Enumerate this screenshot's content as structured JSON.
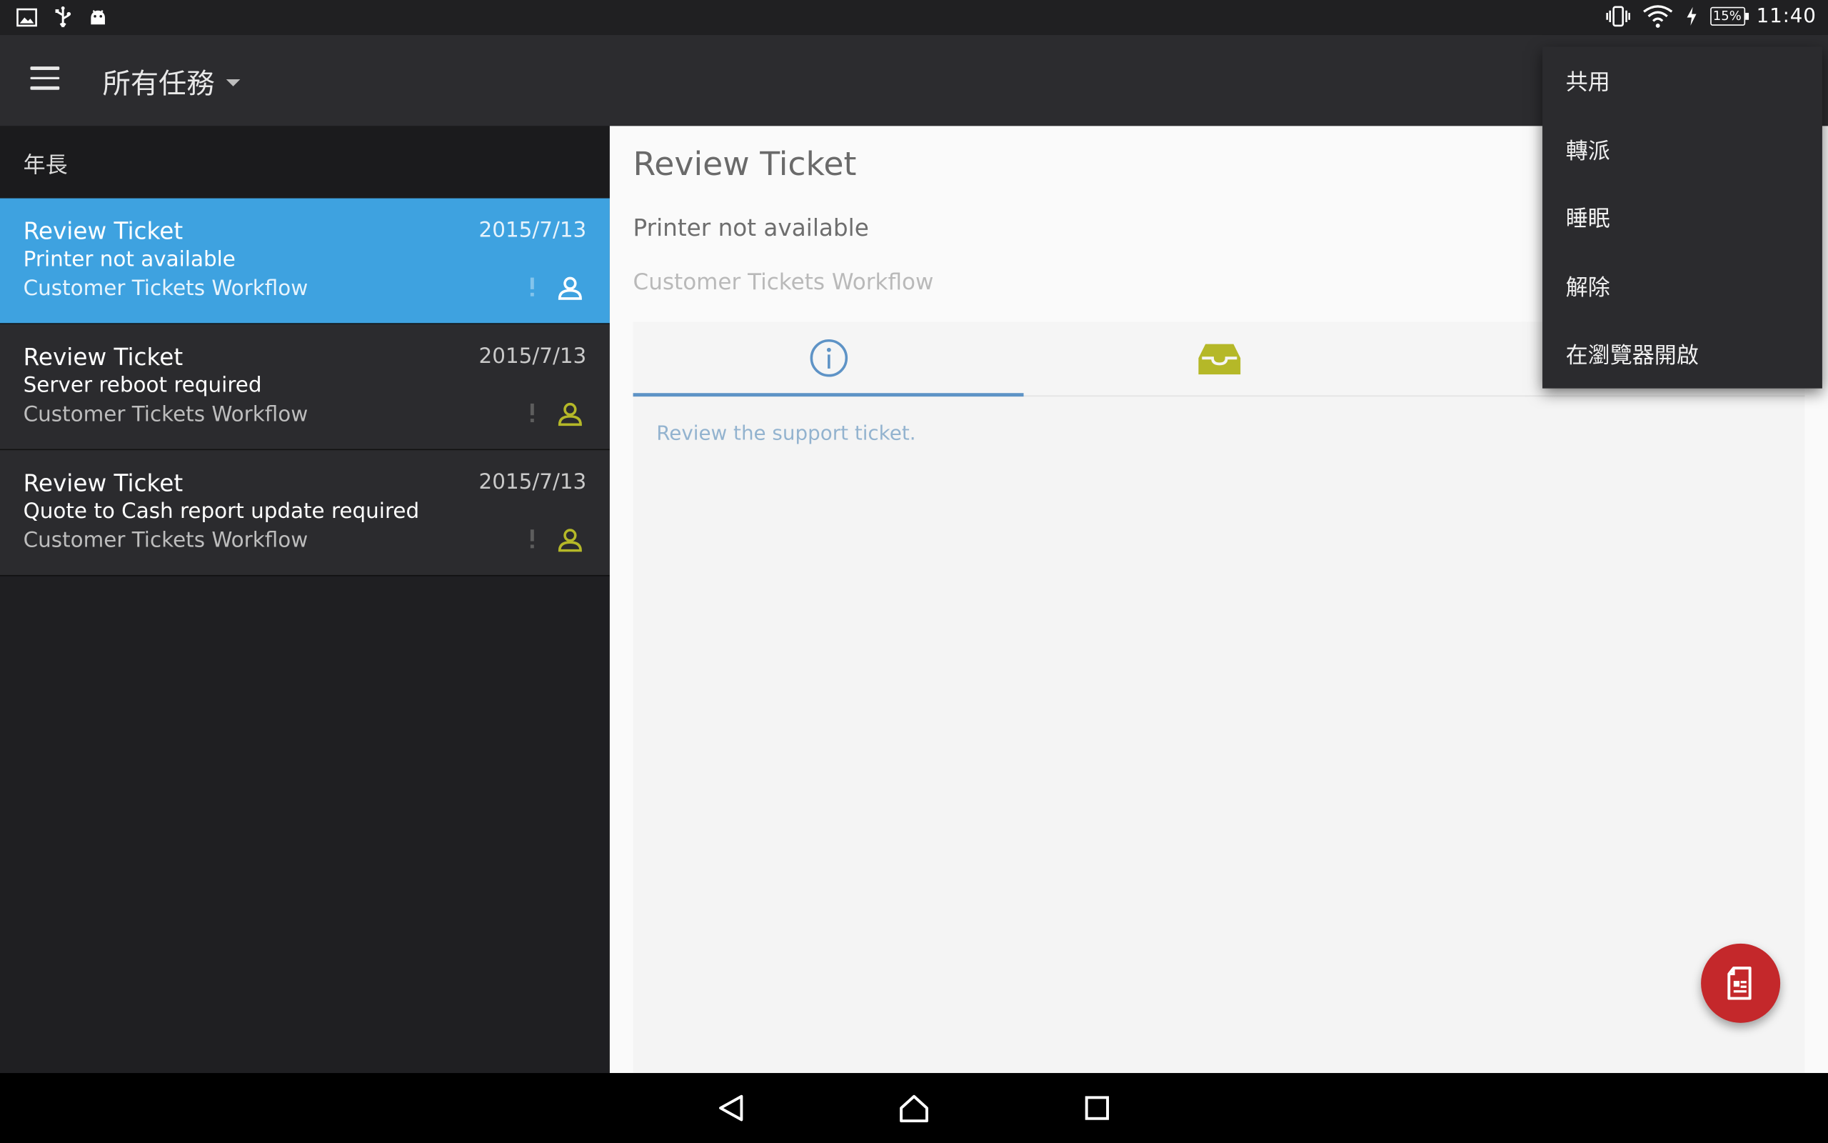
{
  "statusbar": {
    "time": "11:40",
    "battery": "15%",
    "left_icons": [
      "image-icon",
      "usb-icon",
      "android-icon"
    ],
    "right_icons": [
      "vibrate-icon",
      "wifi-icon",
      "charging-icon",
      "battery-icon"
    ]
  },
  "appbar": {
    "title": "所有任務"
  },
  "list": {
    "section_header": "年長",
    "items": [
      {
        "title": "Review Ticket",
        "date": "2015/7/13",
        "subtitle": "Printer not available",
        "workflow": "Customer Tickets Workflow",
        "selected": true
      },
      {
        "title": "Review Ticket",
        "date": "2015/7/13",
        "subtitle": "Server reboot required",
        "workflow": "Customer Tickets Workflow",
        "selected": false
      },
      {
        "title": "Review Ticket",
        "date": "2015/7/13",
        "subtitle": "Quote to Cash report update required",
        "workflow": "Customer Tickets Workflow",
        "selected": false
      }
    ]
  },
  "detail": {
    "title": "Review Ticket",
    "subtitle": "Printer not available",
    "workflow": "Customer Tickets Workflow",
    "tabs": [
      {
        "icon": "info-icon",
        "active": true
      },
      {
        "icon": "inbox-icon",
        "active": false
      }
    ],
    "description": "Review the support ticket."
  },
  "menu": {
    "items": [
      "共用",
      "轉派",
      "睡眠",
      "解除",
      "在瀏覽器開啟"
    ]
  },
  "colors": {
    "selected_row": "#3ea2e0",
    "person_icon": "#b5b828",
    "fab": "#c4282b",
    "tab_indicator": "#5e93c6"
  }
}
